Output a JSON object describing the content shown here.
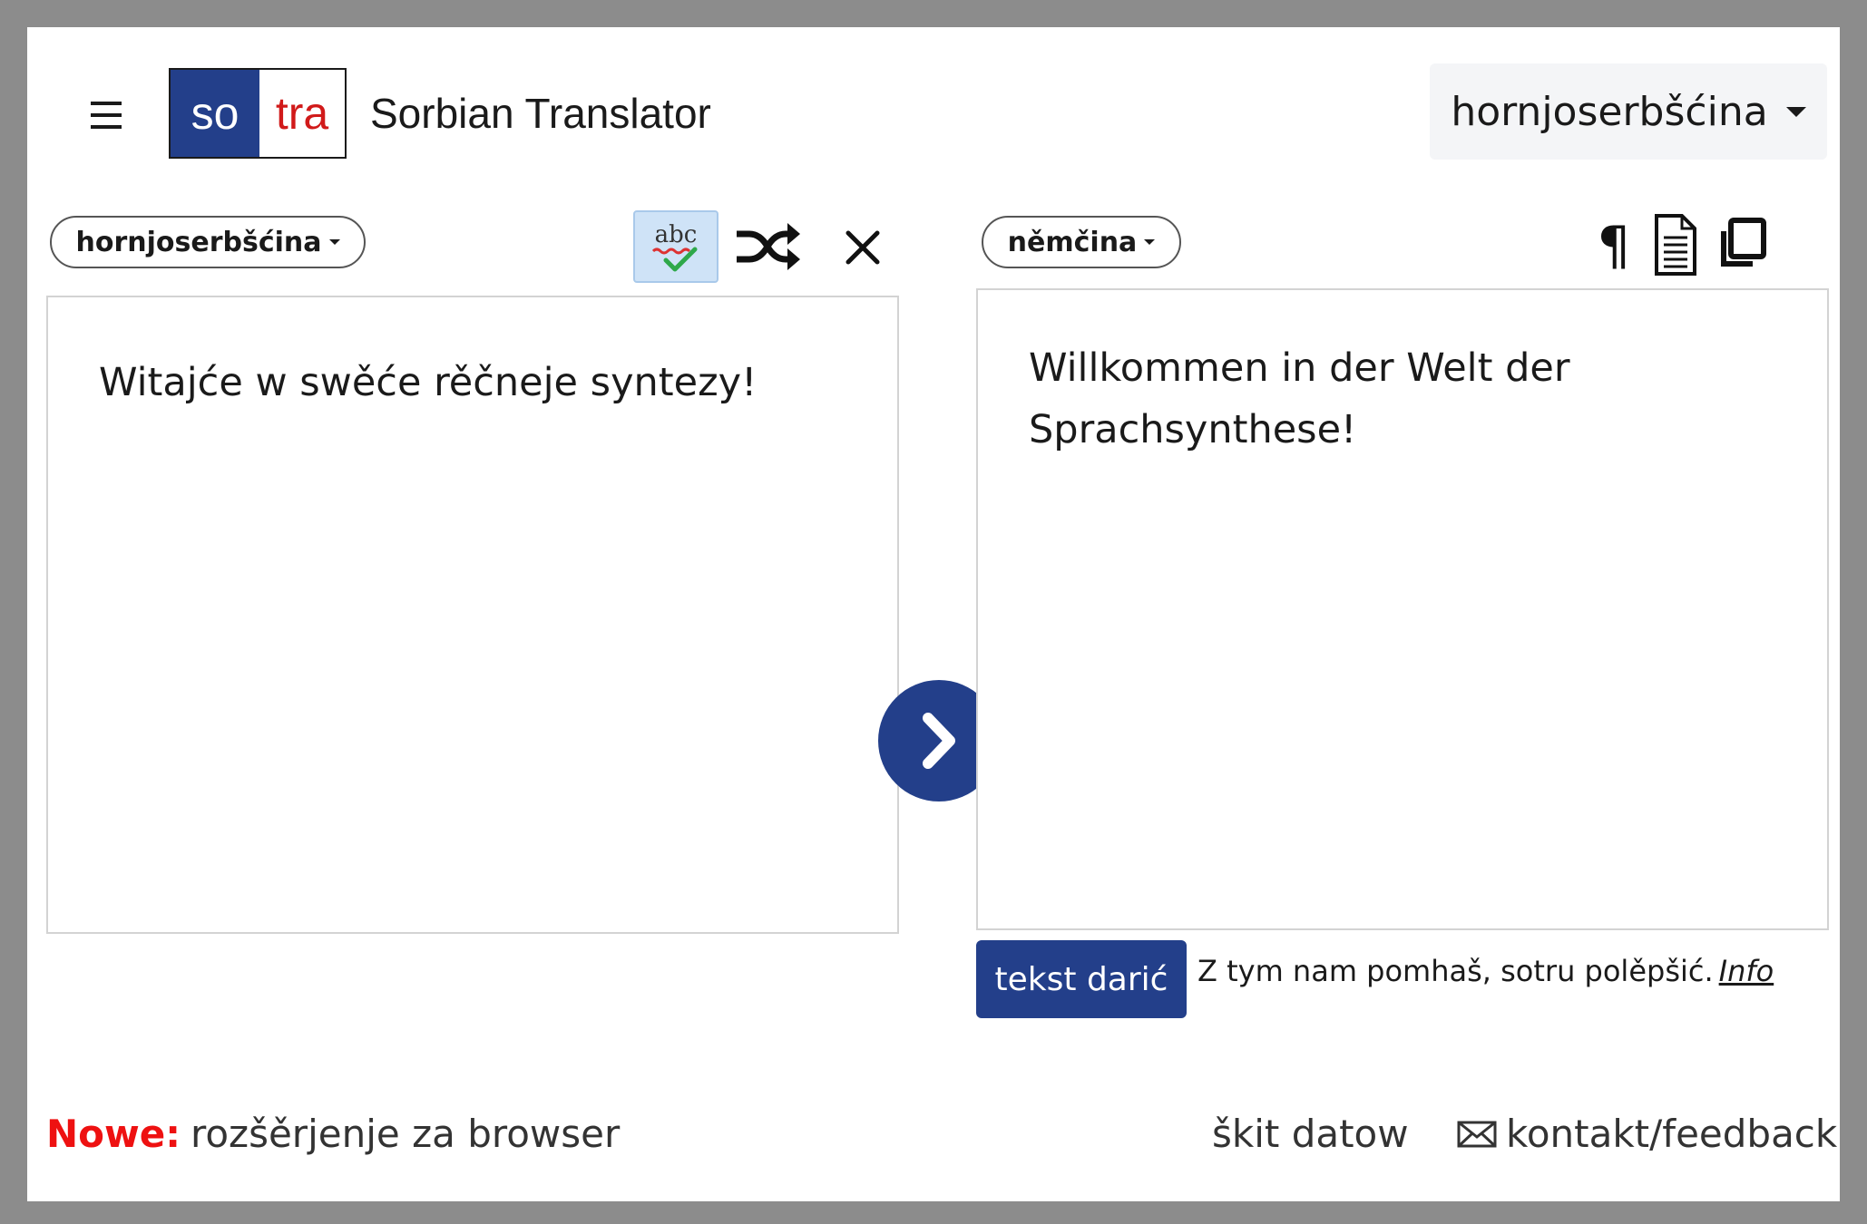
{
  "header": {
    "logo_left": "so",
    "logo_right": "tra",
    "title": "Sorbian Translator",
    "ui_language": "hornjoserbšćina"
  },
  "source": {
    "language": "hornjoserbšćina",
    "text": "Witajće w swěće rěčneje syntezy!"
  },
  "target": {
    "language": "němčina",
    "text": "Willkommen in der Welt der Sprachsynthese!",
    "pilcrow": "¶"
  },
  "donate": {
    "button_label": "tekst darić",
    "note": "Z tym nam pomhaš, sotru polěpšić.",
    "info_link": "Info"
  },
  "footer": {
    "new_label": "Nowe:",
    "extension_link": "rozšěrjenje za browser",
    "privacy_link": "škit datow",
    "contact_link": "kontakt/feedback"
  },
  "colors": {
    "brand_blue": "#233f8a",
    "brand_red": "#d11a1a",
    "new_red": "#ee1111",
    "spell_active_bg": "#cfe3f7"
  },
  "icons": {
    "menu": "hamburger-icon",
    "spell": "spellcheck-icon",
    "shuffle": "shuffle-icon",
    "clear": "close-icon",
    "paragraph": "pilcrow-icon",
    "document": "document-icon",
    "copy": "copy-icon",
    "translate": "chevron-right-icon",
    "mail": "envelope-icon"
  }
}
